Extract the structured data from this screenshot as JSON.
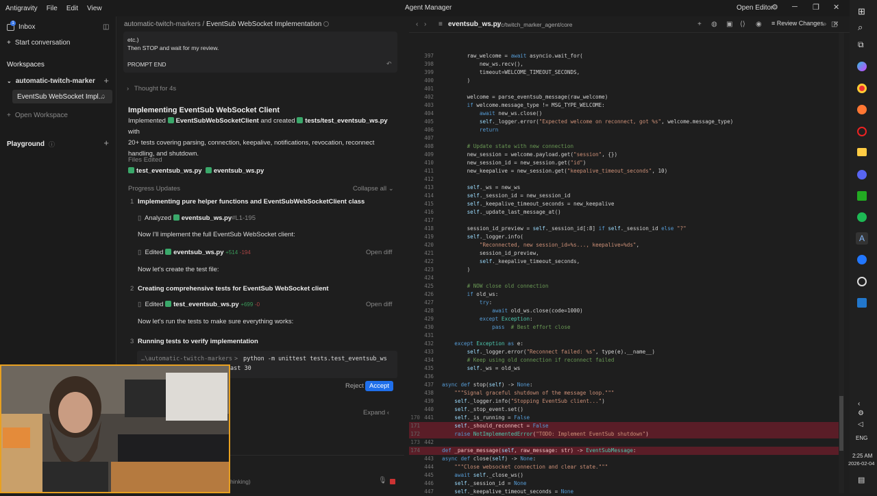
{
  "titlebar": {
    "app": "Antigravity",
    "menu": [
      "File",
      "Edit",
      "View"
    ],
    "center": "Agent Manager",
    "open_editor": "Open Editor"
  },
  "sidebar": {
    "inbox": "Inbox",
    "inbox_badge": "1",
    "start": "Start conversation",
    "workspaces": "Workspaces",
    "workspace_name": "automatic-twitch-marker",
    "conversation": "EventSub WebSocket Impl...",
    "open_workspace": "Open Workspace",
    "playground": "Playground"
  },
  "chat": {
    "breadcrumb_ws": "automatic-twitch-markers",
    "breadcrumb_sep": "/",
    "breadcrumb_conv": "EventSub WebSocket Implementation",
    "prompt_line1": "etc.)",
    "prompt_line2": "Then STOP and wait for my review.",
    "prompt_end": "PROMPT END",
    "thought": "Thought for 4s",
    "heading": "Implementing EventSub WebSocket Client",
    "summary_a": "Implemented",
    "summary_file1": "EventSubWebSocketClient",
    "summary_b": "and created",
    "summary_file2": "tests/test_eventsub_ws.py",
    "summary_c": "with",
    "summary_line2": "20+ tests covering parsing, connection, keepalive, notifications, revocation, reconnect",
    "summary_line3": "handling, and shutdown.",
    "files_edited": "Files Edited",
    "file_a": "test_eventsub_ws.py",
    "file_b": "eventsub_ws.py",
    "progress": "Progress Updates",
    "collapse": "Collapse all",
    "step1_num": "1",
    "step1": "Implementing pure helper functions and EventSubWebSocketClient class",
    "analyzed": "Analyzed",
    "analyzed_file": "eventsub_ws.py",
    "analyzed_range": "#L1-195",
    "now_impl": "Now I'll implement the full EventSub WebSocket client:",
    "edited": "Edited",
    "edited_file1": "eventsub_ws.py",
    "edit1_add": "+514",
    "edit1_del": "-194",
    "open_diff": "Open diff",
    "now_test": "Now let's create the test file:",
    "step2_num": "2",
    "step2": "Creating comprehensive tests for EventSub WebSocket client",
    "edited_file2": "test_eventsub_ws.py",
    "edit2_add": "+699",
    "edit2_del": "-0",
    "now_run": "Now let's run the tests to make sure everything works:",
    "step3_num": "3",
    "step3": "Running tests to verify implementation",
    "cmd_path": "…\\automatic-twitch-markers",
    "cmd_prompt": ">",
    "cmd": "python -m unittest tests.test_eventsub_ws",
    "cmd_line2": "ast 30",
    "reject": "Reject",
    "accept": "Accept",
    "expand": "Expand",
    "thinking": "hinking)"
  },
  "editor": {
    "filename": "eventsub_ws.py",
    "path": "src/twitch_marker_agent/core",
    "review": "Review Changes"
  },
  "code_lines": [
    {
      "n": "397",
      "t": "        raw_welcome = await asyncio.wait_for("
    },
    {
      "n": "398",
      "t": "            new_ws.recv(),"
    },
    {
      "n": "399",
      "t": "            timeout=WELCOME_TIMEOUT_SECONDS,"
    },
    {
      "n": "400",
      "t": "        )"
    },
    {
      "n": "401",
      "t": ""
    },
    {
      "n": "402",
      "t": "        welcome = parse_eventsub_message(raw_welcome)"
    },
    {
      "n": "403",
      "t": "        if welcome.message_type != MSG_TYPE_WELCOME:"
    },
    {
      "n": "404",
      "t": "            await new_ws.close()"
    },
    {
      "n": "405",
      "t": "            self._logger.error(\"Expected welcome on reconnect, got %s\", welcome.message_type)"
    },
    {
      "n": "406",
      "t": "            return"
    },
    {
      "n": "407",
      "t": ""
    },
    {
      "n": "408",
      "t": "        # Update state with new connection"
    },
    {
      "n": "409",
      "t": "        new_session = welcome.payload.get(\"session\", {})"
    },
    {
      "n": "410",
      "t": "        new_session_id = new_session.get(\"id\")"
    },
    {
      "n": "411",
      "t": "        new_keepalive = new_session.get(\"keepalive_timeout_seconds\", 10)"
    },
    {
      "n": "412",
      "t": ""
    },
    {
      "n": "413",
      "t": "        self._ws = new_ws"
    },
    {
      "n": "414",
      "t": "        self._session_id = new_session_id"
    },
    {
      "n": "415",
      "t": "        self._keepalive_timeout_seconds = new_keepalive"
    },
    {
      "n": "416",
      "t": "        self._update_last_message_at()"
    },
    {
      "n": "417",
      "t": ""
    },
    {
      "n": "418",
      "t": "        session_id_preview = self._session_id[:8] if self._session_id else \"?\""
    },
    {
      "n": "419",
      "t": "        self._logger.info("
    },
    {
      "n": "420",
      "t": "            \"Reconnected, new session_id=%s..., keepalive=%ds\","
    },
    {
      "n": "421",
      "t": "            session_id_preview,"
    },
    {
      "n": "422",
      "t": "            self._keepalive_timeout_seconds,"
    },
    {
      "n": "423",
      "t": "        )"
    },
    {
      "n": "424",
      "t": ""
    },
    {
      "n": "425",
      "t": "        # NOW close old connection"
    },
    {
      "n": "426",
      "t": "        if old_ws:"
    },
    {
      "n": "427",
      "t": "            try:"
    },
    {
      "n": "428",
      "t": "                await old_ws.close(code=1000)"
    },
    {
      "n": "429",
      "t": "            except Exception:"
    },
    {
      "n": "430",
      "t": "                pass  # Best effort close"
    },
    {
      "n": "431",
      "t": ""
    },
    {
      "n": "432",
      "t": "    except Exception as e:"
    },
    {
      "n": "433",
      "t": "        self._logger.error(\"Reconnect failed: %s\", type(e).__name__)"
    },
    {
      "n": "434",
      "t": "        # Keep using old connection if reconnect failed"
    },
    {
      "n": "435",
      "t": "        self._ws = old_ws"
    },
    {
      "n": "436",
      "t": ""
    },
    {
      "n": "437",
      "t": "async def stop(self) -> None:"
    },
    {
      "n": "438",
      "t": "    \"\"\"Signal graceful shutdown of the message loop.\"\"\""
    },
    {
      "n": "439",
      "t": "    self._logger.info(\"Stopping EventSub client...\")"
    },
    {
      "n": "440",
      "t": "    self._stop_event.set()"
    },
    {
      "n": "441",
      "o": "170",
      "t": "    self._is_running = False"
    },
    {
      "n": "",
      "o": "171",
      "t": "    self._should_reconnect = False",
      "del": true
    },
    {
      "n": "",
      "o": "172",
      "t": "    raise NotImplementedError(\"TODO: Implement EventSub shutdown\")",
      "del": true
    },
    {
      "n": "442",
      "o": "173",
      "t": ""
    },
    {
      "n": "",
      "o": "174",
      "t": "def _parse_message(self, raw_message: str) -> EventSubMessage:",
      "del": true
    },
    {
      "n": "443",
      "t": "async def close(self) -> None:"
    },
    {
      "n": "444",
      "t": "    \"\"\"Close websocket connection and clear state.\"\"\""
    },
    {
      "n": "445",
      "t": "    await self._close_ws()"
    },
    {
      "n": "446",
      "t": "    self._session_id = None"
    },
    {
      "n": "447",
      "t": "    self._keepalive_timeout_seconds = None"
    }
  ],
  "taskbar": {
    "lang": "ENG",
    "time": "2:25 AM",
    "date": "2026-02-04"
  }
}
